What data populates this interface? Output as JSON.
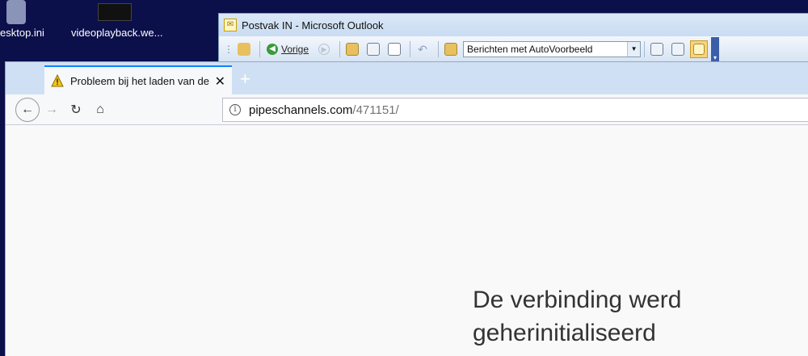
{
  "desktop": {
    "icons": [
      {
        "label": "esktop.ini"
      },
      {
        "label": "videoplayback.we..."
      }
    ]
  },
  "outlook": {
    "title": "Postvak IN - Microsoft Outlook",
    "toolbar": {
      "back_label": "Vorige",
      "view_select": "Berichten met AutoVoorbeeld"
    }
  },
  "browser": {
    "tab": {
      "title": "Probleem bij het laden van de p",
      "new_tab": "+"
    },
    "url": {
      "host": "pipeschannels.com",
      "path": "/471151/"
    },
    "error": {
      "title": "De verbinding werd geherinitialiseerd"
    }
  }
}
